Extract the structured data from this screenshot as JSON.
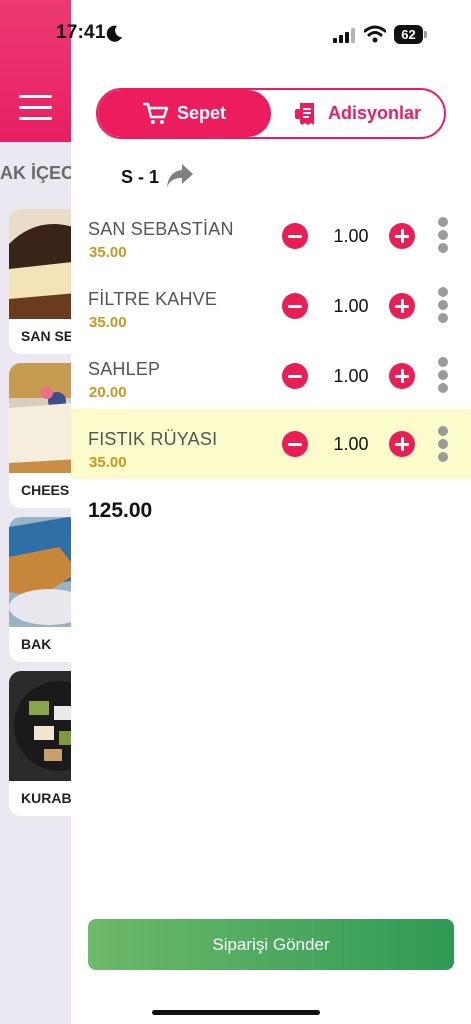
{
  "status_bar": {
    "time": "17:41",
    "battery": "62"
  },
  "left_panel": {
    "category": "AK İÇEC",
    "products": [
      {
        "label": "SAN SE"
      },
      {
        "label": "CHEES"
      },
      {
        "label": "BAK"
      },
      {
        "label": "KURAB"
      }
    ]
  },
  "tabs": {
    "cart_label": "Sepet",
    "tickets_label": "Adisyonlar"
  },
  "table": {
    "label": "S - 1"
  },
  "order_items": [
    {
      "name": "SAN SEBASTİAN",
      "price": "35.00",
      "quantity": "1.00"
    },
    {
      "name": "FİLTRE KAHVE",
      "price": "35.00",
      "quantity": "1.00"
    },
    {
      "name": "SAHLEP",
      "price": "20.00",
      "quantity": "1.00"
    },
    {
      "name": "FISTIK RÜYASI",
      "price": "35.00",
      "quantity": "1.00"
    }
  ],
  "total": "125.00",
  "send_button_label": "Siparişi Gönder",
  "colors": {
    "accent": "#ec1d5e",
    "price": "#c9961f",
    "highlight": "#fbfbcb",
    "send": "#3ea35c"
  }
}
